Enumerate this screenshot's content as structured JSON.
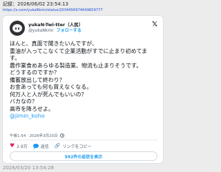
{
  "record": {
    "label": "記録：2026/06/02 23:54:13",
    "url": "https://x.com/yukaNkmr/status/2034456974649659777"
  },
  "post": {
    "display_name": "yukaN-Twi-tter（人民）",
    "handle": "@yukaNkmr",
    "follow_label": "フォローする",
    "body_lines": [
      "ほんと、真面で聞きたいんですが、",
      "重油が入ってこなくて企業活動がすでに止まり初めてま",
      "す。",
      "農作業食めあらゆる製造業、物流も止まりそうです。",
      "どうするのですか？",
      "備蓄放出して終わり？",
      "お金あっても何も買えなくなる。",
      "何万人と人が死んでもいいの？",
      "バカなの？",
      "高市を降ろせよ。"
    ],
    "mention": "@jimin_koho",
    "timestamp": "午後1:54 · 2026年3月20日",
    "likes": "2.9万",
    "reply_label": "返信",
    "copy_link_label": "リンクをコピー",
    "more_replies_label": "592件の返信を表示"
  },
  "footer_timestamp": "2026/03/20 13:54:28",
  "colors": {
    "link_blue": "#1d9bf0",
    "like_red": "#e0245e",
    "muted_gray": "#536471"
  }
}
